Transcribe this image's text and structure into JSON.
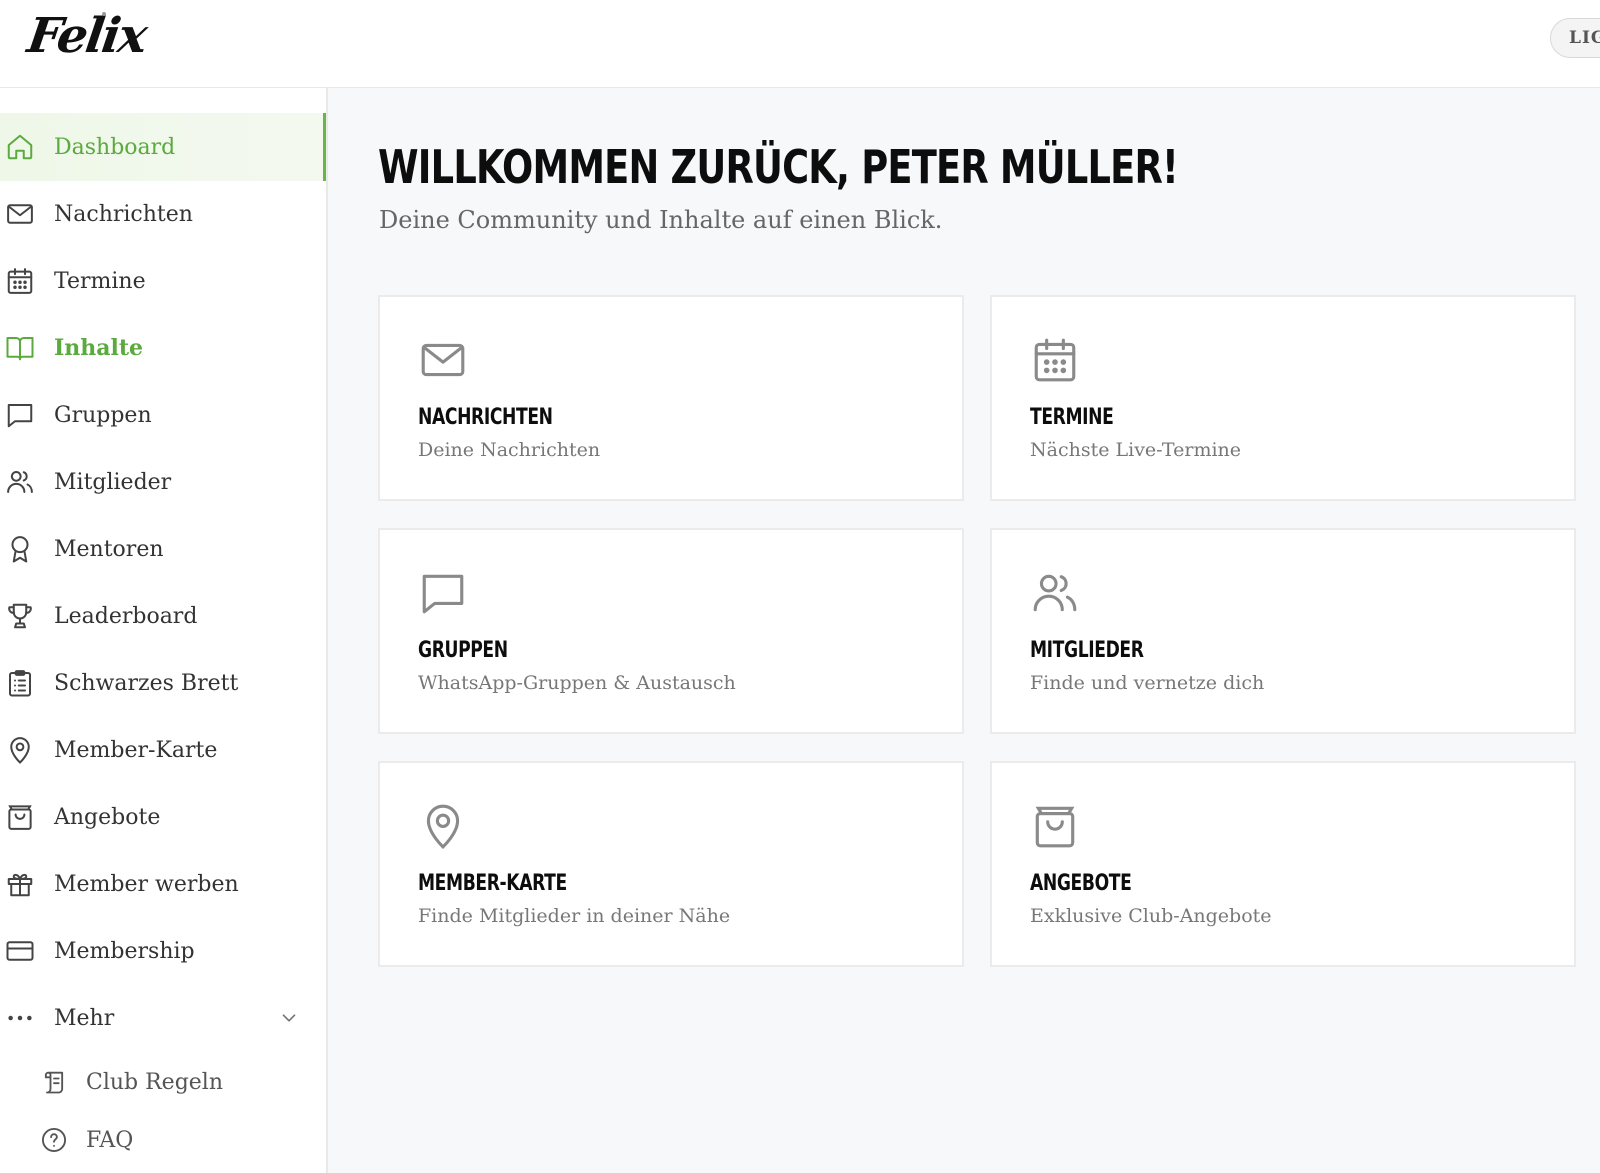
{
  "header": {
    "logo": "Felix",
    "theme_toggle": "LIG"
  },
  "sidebar": {
    "items": [
      {
        "label": "Dashboard",
        "icon": "home-icon",
        "state": "active"
      },
      {
        "label": "Nachrichten",
        "icon": "mail-icon"
      },
      {
        "label": "Termine",
        "icon": "calendar-icon"
      },
      {
        "label": "Inhalte",
        "icon": "book-open-icon",
        "state": "highlight"
      },
      {
        "label": "Gruppen",
        "icon": "chat-icon"
      },
      {
        "label": "Mitglieder",
        "icon": "users-icon"
      },
      {
        "label": "Mentoren",
        "icon": "award-icon"
      },
      {
        "label": "Leaderboard",
        "icon": "trophy-icon"
      },
      {
        "label": "Schwarzes Brett",
        "icon": "clipboard-icon"
      },
      {
        "label": "Member-Karte",
        "icon": "map-pin-icon"
      },
      {
        "label": "Angebote",
        "icon": "shopping-bag-icon"
      },
      {
        "label": "Member werben",
        "icon": "gift-icon"
      },
      {
        "label": "Membership",
        "icon": "credit-card-icon"
      },
      {
        "label": "Mehr",
        "icon": "more-dots-icon"
      }
    ],
    "sub_items": [
      {
        "label": "Club Regeln",
        "icon": "scroll-icon"
      },
      {
        "label": "FAQ",
        "icon": "help-circle-icon"
      }
    ]
  },
  "main": {
    "title": "WILLKOMMEN ZURÜCK, PETER MÜLLER!",
    "subtitle": "Deine Community und Inhalte auf einen Blick.",
    "cards": [
      {
        "title": "NACHRICHTEN",
        "desc": "Deine Nachrichten",
        "icon": "mail-icon"
      },
      {
        "title": "TERMINE",
        "desc": "Nächste Live-Termine",
        "icon": "calendar-icon"
      },
      {
        "title": "GRUPPEN",
        "desc": "WhatsApp-Gruppen & Austausch",
        "icon": "chat-icon"
      },
      {
        "title": "MITGLIEDER",
        "desc": "Finde und vernetze dich",
        "icon": "users-icon"
      },
      {
        "title": "MEMBER-KARTE",
        "desc": "Finde Mitglieder in deiner Nähe",
        "icon": "map-pin-icon"
      },
      {
        "title": "ANGEBOTE",
        "desc": "Exklusive Club-Angebote",
        "icon": "shopping-bag-icon"
      }
    ]
  },
  "colors": {
    "accent": "#5aaa3e",
    "active_bg": "#eef7e8",
    "icon_gray": "#8a8a8a",
    "title_black": "#0d0d0d"
  }
}
